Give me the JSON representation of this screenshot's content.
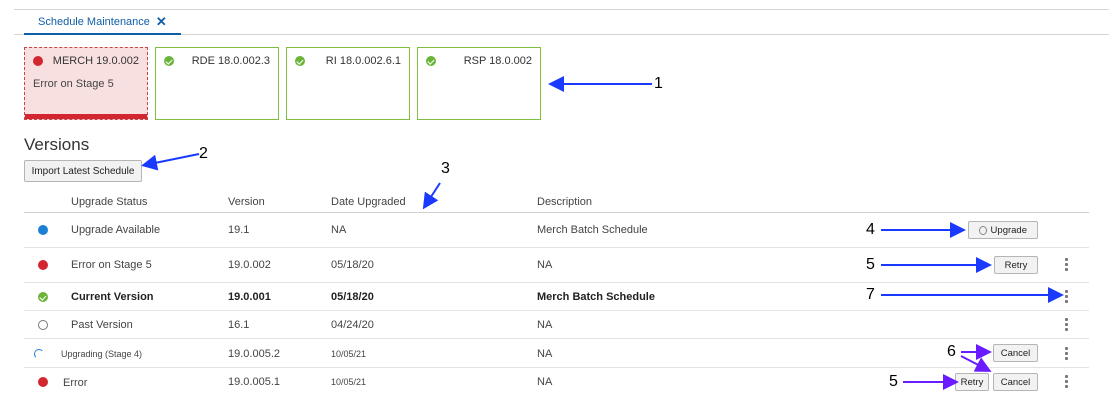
{
  "tab": {
    "label": "Schedule Maintenance",
    "close": "✕"
  },
  "cards": [
    {
      "name": "MERCH 19.0.002",
      "status": "error",
      "sub": "Error on Stage 5"
    },
    {
      "name": "RDE 18.0.002.3",
      "status": "ok",
      "sub": ""
    },
    {
      "name": "RI 18.0.002.6.1",
      "status": "ok",
      "sub": ""
    },
    {
      "name": "RSP 18.0.002",
      "status": "ok",
      "sub": ""
    }
  ],
  "versions": {
    "title": "Versions",
    "import_label": "Import Latest Schedule",
    "headers": {
      "status": "Upgrade Status",
      "version": "Version",
      "date": "Date Upgraded",
      "description": "Description"
    },
    "rows": [
      {
        "status": "Upgrade Available",
        "version": "19.1",
        "date": "NA",
        "description": "Merch Batch Schedule",
        "action": "Upgrade"
      },
      {
        "status": "Error on Stage 5",
        "version": "19.0.002",
        "date": "05/18/20",
        "description": "NA",
        "action": "Retry"
      },
      {
        "status": "Current Version",
        "version": "19.0.001",
        "date": "05/18/20",
        "description": "Merch Batch Schedule"
      },
      {
        "status": "Past Version",
        "version": "16.1",
        "date": "04/24/20",
        "description": "NA"
      },
      {
        "status": "Upgrading (Stage 4)",
        "version": "19.0.005.2",
        "date": "10/05/21",
        "description": "NA",
        "action": "Cancel"
      },
      {
        "status": "Error",
        "version": "19.0.005.1",
        "date": "10/05/21",
        "description": "NA",
        "action": "Retry",
        "action2": "Cancel"
      }
    ]
  },
  "callouts": {
    "n1": "1",
    "n2": "2",
    "n3": "3",
    "n4": "4",
    "n5a": "5",
    "n7": "7",
    "n6": "6",
    "n5b": "5"
  },
  "colors": {
    "accent": "#0f5fa8",
    "error": "#d22630",
    "ok": "#6bb43a",
    "info": "#1c7fd6",
    "arrow": "#1a3bff",
    "arrow_purple": "#6a1bff"
  }
}
